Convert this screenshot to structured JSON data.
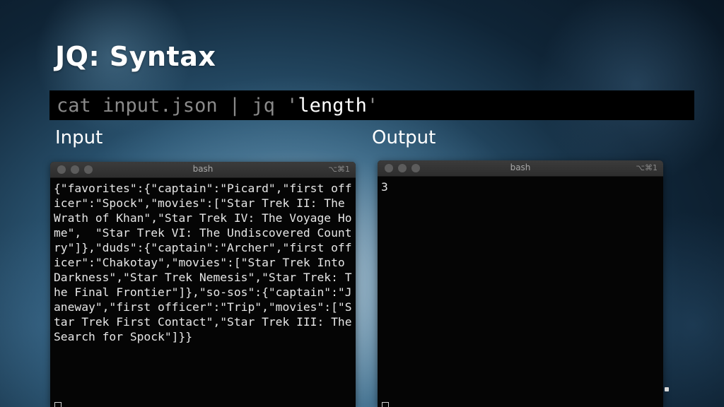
{
  "slide": {
    "title": "JQ: Syntax"
  },
  "command": {
    "prefix": "cat input.json | jq '",
    "filter": "length",
    "suffix": "'"
  },
  "labels": {
    "input": "Input",
    "output": "Output"
  },
  "input_terminal": {
    "title": "bash",
    "shortcut": "⌥⌘1",
    "content": "{\"favorites\":{\"captain\":\"Picard\",\"first officer\":\"Spock\",\"movies\":[\"Star Trek II: The Wrath of Khan\",\"Star Trek IV: The Voyage Home\",  \"Star Trek VI: The Undiscovered Country\"]},\"duds\":{\"captain\":\"Archer\",\"first officer\":\"Chakotay\",\"movies\":[\"Star Trek Into Darkness\",\"Star Trek Nemesis\",\"Star Trek: The Final Frontier\"]},\"so-sos\":{\"captain\":\"Janeway\",\"first officer\":\"Trip\",\"movies\":[\"Star Trek First Contact\",\"Star Trek III: The Search for Spock\"]}}"
  },
  "output_terminal": {
    "title": "bash",
    "shortcut": "⌥⌘1",
    "content": "3"
  },
  "icons": {
    "window_buttons": [
      "close-icon",
      "minimize-icon",
      "zoom-icon"
    ]
  }
}
